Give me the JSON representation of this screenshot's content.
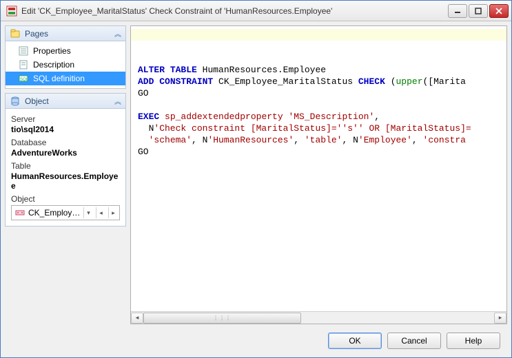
{
  "window": {
    "title": "Edit 'CK_Employee_MaritalStatus' Check Constraint of 'HumanResources.Employee'"
  },
  "pages_panel": {
    "title": "Pages",
    "items": [
      {
        "label": "Properties",
        "selected": false
      },
      {
        "label": "Description",
        "selected": false
      },
      {
        "label": "SQL definition",
        "selected": true
      }
    ]
  },
  "object_panel": {
    "title": "Object",
    "server_label": "Server",
    "server_value": "tio\\sql2014",
    "database_label": "Database",
    "database_value": "AdventureWorks",
    "table_label": "Table",
    "table_value": "HumanResources.Employee",
    "object_label": "Object",
    "picker_text": "CK_Employee_M..."
  },
  "sql": {
    "l1_kw1": "ALTER",
    "l1_kw2": "TABLE",
    "l1_rest": " HumanResources.Employee",
    "l2_kw1": "ADD",
    "l2_kw2": "CONSTRAINT",
    "l2_mid": " CK_Employee_MaritalStatus ",
    "l2_kw3": "CHECK",
    "l2_paren": " (",
    "l2_fn": "upper",
    "l2_tail": "([Marita",
    "l3": "GO",
    "l5_kw": "EXEC",
    "l5_proc": " sp_addextendedproperty ",
    "l5_s1": "'MS_Description'",
    "l5_comma": ",",
    "l6_pre": "  N",
    "l6_s1": "'Check constraint [MaritalStatus]=''s'' OR [MaritalStatus]=",
    "l7_pre": "  ",
    "l7_s1": "'schema'",
    "l7_c1": ", N",
    "l7_s2": "'HumanResources'",
    "l7_c2": ", ",
    "l7_s3": "'table'",
    "l7_c3": ", N",
    "l7_s4": "'Employee'",
    "l7_c4": ", ",
    "l7_s5": "'constra",
    "l8": "GO"
  },
  "buttons": {
    "ok": "OK",
    "cancel": "Cancel",
    "help": "Help"
  }
}
